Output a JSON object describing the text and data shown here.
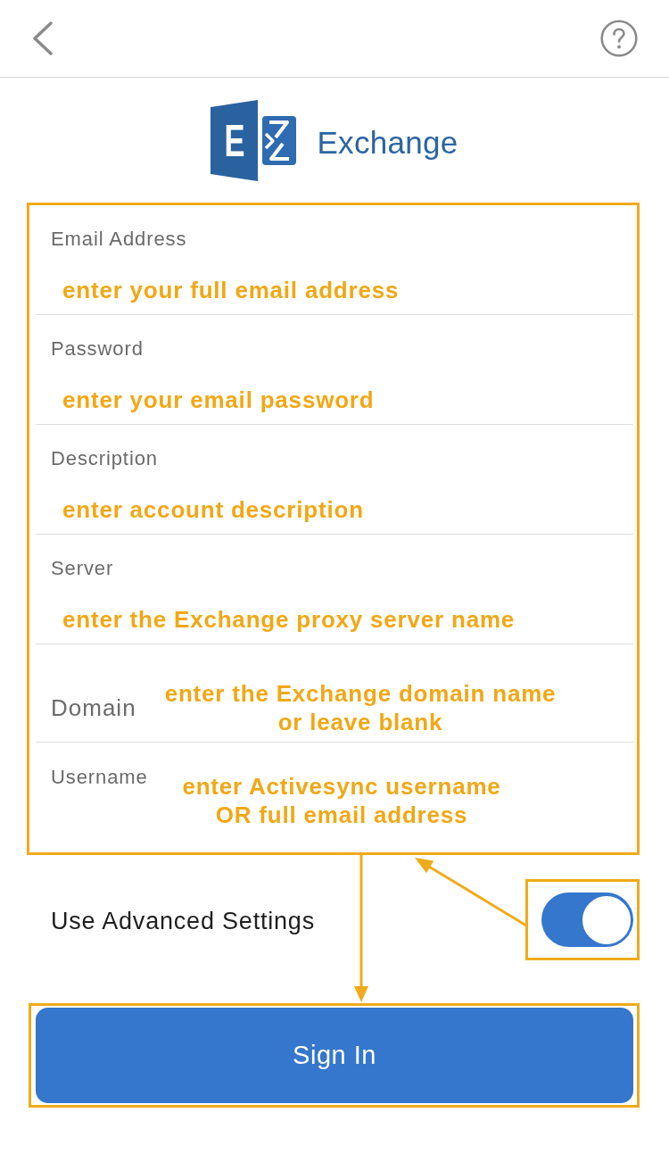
{
  "logo": {
    "mark": "E",
    "name": "Exchange"
  },
  "fields": [
    {
      "kind": "stacked",
      "label": "Email Address",
      "annotation": "enter your full email address"
    },
    {
      "kind": "stacked",
      "label": "Password",
      "annotation": "enter your email password"
    },
    {
      "kind": "stacked",
      "label": "Description",
      "annotation": "enter account description"
    },
    {
      "kind": "stacked",
      "label": "Server",
      "annotation": "enter the Exchange proxy server name"
    },
    {
      "kind": "inline",
      "label": "Domain",
      "annotation": "enter the Exchange domain name\nor leave blank"
    },
    {
      "kind": "hanging",
      "label": "Username",
      "annotation": "enter Activesync username\nOR full email address"
    }
  ],
  "advanced_settings": {
    "label": "Use Advanced Settings",
    "on": true
  },
  "sign_in_button": {
    "label": "Sign In"
  }
}
